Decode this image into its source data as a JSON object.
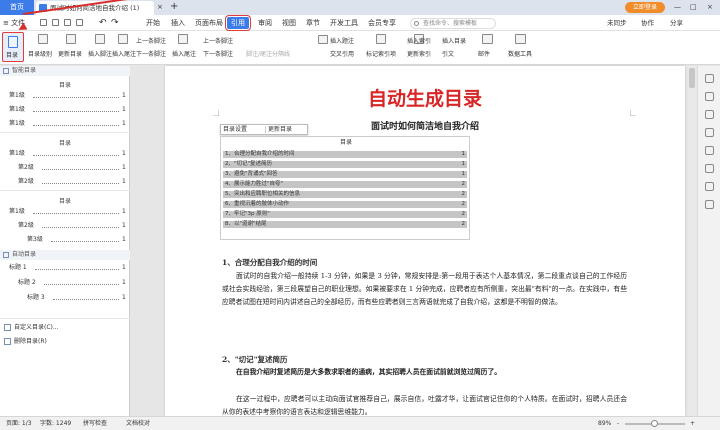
{
  "tabbar": {
    "home": "首页",
    "doc_title": "面试时如何简洁地自我介绍 (1)",
    "close": "×",
    "plus": "+",
    "login": "立即登录",
    "min": "—",
    "max": "□",
    "close_win": "×"
  },
  "menubar": {
    "file": "文件",
    "tabs": [
      "开始",
      "插入",
      "页面布局",
      "引用",
      "审阅",
      "视图",
      "章节",
      "开发工具",
      "会员专享"
    ],
    "active": "引用",
    "search": "查找命令、搜索模板",
    "sync": "未同步",
    "collab": "协作",
    "share": "分享"
  },
  "toolbar": {
    "toc": "目录",
    "toc_level": "目录级别",
    "update_toc": "更新目录",
    "insert_footnote": "插入脚注",
    "insert_endnote": "插入尾注",
    "prev_footnote": "上一条脚注",
    "next_footnote": "下一条脚注",
    "footnote_endnote_sep": "脚注/尾注分隔线",
    "insert_caption": "插入题注",
    "cross_ref": "交叉引用",
    "mark_index": "标记索引项",
    "insert_index": "插入索引",
    "update_index": "更新索引",
    "insert_toa": "插入目录",
    "citation": "引文",
    "bibliography": "书目",
    "mail": "邮件",
    "data_tools": "数据工具"
  },
  "panel": {
    "builtin": "智能目录",
    "title": "目录",
    "blocks": [
      [
        {
          "t": "第1级",
          "p": "1"
        },
        {
          "t": "第1级",
          "p": "1"
        },
        {
          "t": "第1级",
          "p": "1"
        }
      ],
      [
        {
          "t": "第1级",
          "p": "1"
        },
        {
          "t": "第2级",
          "p": "1"
        },
        {
          "t": "第2级",
          "p": "1"
        }
      ],
      [
        {
          "t": "第1级",
          "p": "1"
        },
        {
          "t": "第2级",
          "p": "1"
        },
        {
          "t": "第3级",
          "p": "1"
        }
      ]
    ],
    "auto_section": "自动目录",
    "auto_rows": [
      {
        "t": "标题 1",
        "p": "1"
      },
      {
        "t": "标题 2",
        "p": "1"
      },
      {
        "t": "标题 3",
        "p": "1"
      }
    ],
    "custom": "自定义目录(C)...",
    "delete": "删除目录(R)"
  },
  "doc": {
    "big_title": "自动生成目录",
    "subtitle": "面试时如何简洁地自我介绍",
    "ctx_settings": "目录设置",
    "ctx_update": "更新目录",
    "toc_heading": "目录",
    "toc_rows": [
      {
        "t": "1、合理分配自我介绍的时间",
        "p": "1"
      },
      {
        "t": "2、\"切记\"复述简历",
        "p": "1"
      },
      {
        "t": "3、避免\"背诵式\"回答",
        "p": "1"
      },
      {
        "t": "4、展示能力胜过\"自夸\"",
        "p": "2"
      },
      {
        "t": "5、突出和应聘职位相关的信息",
        "p": "2"
      },
      {
        "t": "6、重视沉着的肢体小动作",
        "p": "2"
      },
      {
        "t": "7、牢记\"3p 原则\"",
        "p": "2"
      },
      {
        "t": "8、以\"道谢\"结尾",
        "p": "2"
      }
    ],
    "h1": "1、合理分配自我介绍的时间",
    "p1": "面试时的自我介绍一般持续 1-3 分钟，如果是 3 分钟，常规安排是:第一段用于表达个人基本情况，第二段重点谈自己的工作经历或社会实践经验，第三段展望自己的职业理想。如果被要求在 1 分钟完成，应聘者应有所侧重，突出最\"有料\"的一点。在实践中，有些应聘者试图在短时间内讲述自己的全部经历，而有些应聘者则三言两语就完成了自我介绍，这都是不明智的做法。",
    "h2": "2、\"切记\"复述简历",
    "p2": "在自我介绍时复述简历是大多数求职者的通病，其实招聘人员在面试前就浏览过简历了。",
    "p3": "在这一过程中，应聘者可以主动向面试官推荐自己，展示自信，吐露才华，让面试官记住你的个人特质。在面试时，招聘人员还会从你的表述中考察你的语言表达和逻辑思维能力。"
  },
  "status": {
    "page": "页面: 1/3",
    "words": "字数: 1249",
    "spell": "拼写检查",
    "align": "文档校对",
    "zoom": "89%",
    "minus": "-",
    "plus": "+"
  }
}
